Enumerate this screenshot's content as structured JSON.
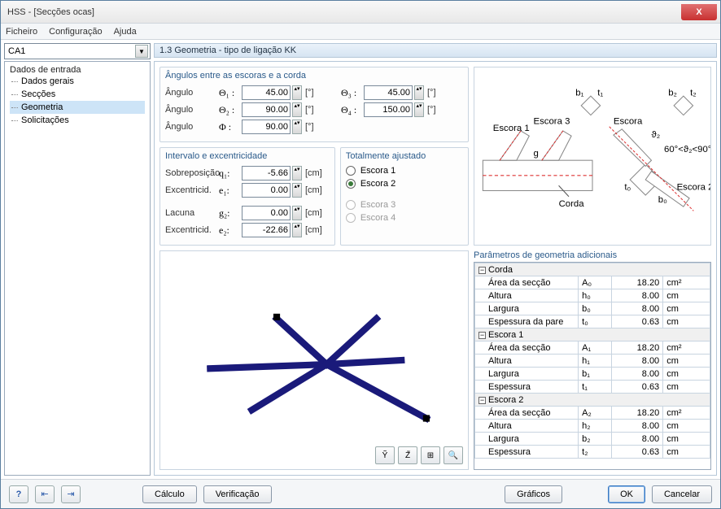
{
  "window": {
    "title": "HSS - [Secções ocas]",
    "close": "X"
  },
  "menu": {
    "file": "Ficheiro",
    "config": "Configuração",
    "help": "Ajuda"
  },
  "case_selector": {
    "value": "CA1"
  },
  "tree": {
    "root": "Dados de entrada",
    "items": [
      "Dados gerais",
      "Secções",
      "Geometria",
      "Solicitações"
    ],
    "selected_index": 2
  },
  "section": {
    "title": "1.3 Geometria - tipo de ligação KK"
  },
  "angles": {
    "title": "Ângulos entre as escoras e a corda",
    "rows": [
      {
        "label": "Ângulo",
        "sym1": "Θ₁ :",
        "val1": "45.00",
        "unit": "[°]",
        "sym2": "Θ₃ :",
        "val2": "45.00"
      },
      {
        "label": "Ângulo",
        "sym1": "Θ₂ :",
        "val1": "90.00",
        "unit": "[°]",
        "sym2": "Θ₄ :",
        "val2": "150.00"
      },
      {
        "label": "Ângulo",
        "sym1": "Φ :",
        "val1": "90.00",
        "unit": "[°]"
      }
    ]
  },
  "interval": {
    "title": "Intervalo e excentricidade",
    "rows": [
      {
        "label": "Sobreposição",
        "sym": "q₁:",
        "val": "-5.66",
        "unit": "[cm]"
      },
      {
        "label": "Excentricid.",
        "sym": "e₁:",
        "val": "0.00",
        "unit": "[cm]"
      },
      {
        "label": "Lacuna",
        "sym": "g₂:",
        "val": "0.00",
        "unit": "[cm]"
      },
      {
        "label": "Excentricid.",
        "sym": "e₂:",
        "val": "-22.66",
        "unit": "[cm]"
      }
    ]
  },
  "adjust": {
    "title": "Totalmente ajustado",
    "options": [
      {
        "label": "Escora 1",
        "selected": false,
        "enabled": true
      },
      {
        "label": "Escora 2",
        "selected": true,
        "enabled": true
      },
      {
        "label": "Escora 3",
        "selected": false,
        "enabled": false
      },
      {
        "label": "Escora 4",
        "selected": false,
        "enabled": false
      }
    ]
  },
  "diagram": {
    "labels": {
      "e1": "Escora 1",
      "e3": "Escora 3",
      "e2": "Escora 2",
      "esc": "Escora",
      "chord": "Corda",
      "b1": "b₁",
      "t1": "t₁",
      "b2": "b₂",
      "t2": "t₂",
      "g": "g",
      "theta2": "ϑ₂",
      "t0": "t₀",
      "b0": "b₀",
      "range": "60°<ϑ₂<90°"
    }
  },
  "params": {
    "title": "Parâmetros de geometria adicionais",
    "groups": [
      {
        "name": "Corda",
        "rows": [
          {
            "label": "Área da secção",
            "sym": "A₀",
            "val": "18.20",
            "unit": "cm²"
          },
          {
            "label": "Altura",
            "sym": "h₀",
            "val": "8.00",
            "unit": "cm"
          },
          {
            "label": "Largura",
            "sym": "b₀",
            "val": "8.00",
            "unit": "cm"
          },
          {
            "label": "Espessura da pare",
            "sym": "t₀",
            "val": "0.63",
            "unit": "cm"
          }
        ]
      },
      {
        "name": "Escora 1",
        "rows": [
          {
            "label": "Área da secção",
            "sym": "A₁",
            "val": "18.20",
            "unit": "cm²"
          },
          {
            "label": "Altura",
            "sym": "h₁",
            "val": "8.00",
            "unit": "cm"
          },
          {
            "label": "Largura",
            "sym": "b₁",
            "val": "8.00",
            "unit": "cm"
          },
          {
            "label": "Espessura",
            "sym": "t₁",
            "val": "0.63",
            "unit": "cm"
          }
        ]
      },
      {
        "name": "Escora 2",
        "rows": [
          {
            "label": "Área da secção",
            "sym": "A₂",
            "val": "18.20",
            "unit": "cm²"
          },
          {
            "label": "Altura",
            "sym": "h₂",
            "val": "8.00",
            "unit": "cm"
          },
          {
            "label": "Largura",
            "sym": "b₂",
            "val": "8.00",
            "unit": "cm"
          },
          {
            "label": "Espessura",
            "sym": "t₂",
            "val": "0.63",
            "unit": "cm"
          }
        ]
      }
    ]
  },
  "render_toolbar": {
    "b1": "Ỹ",
    "b2": "Z̃",
    "b3": "⊞",
    "b4": "🔍"
  },
  "footer": {
    "help_icon": "?",
    "prev_icon": "⇤",
    "next_icon": "⇥",
    "calc": "Cálculo",
    "verify": "Verificação",
    "graphs": "Gráficos",
    "ok": "OK",
    "cancel": "Cancelar"
  }
}
